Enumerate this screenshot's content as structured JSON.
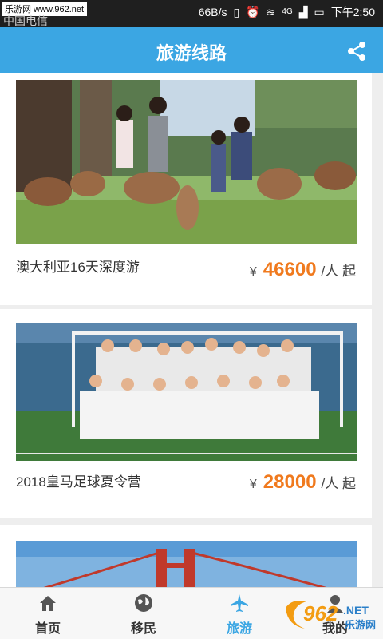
{
  "status_bar": {
    "watermark": "乐游网 www.962.net",
    "carrier": "中国电信",
    "speed": "66B/s",
    "network": "4G",
    "time": "下午2:50"
  },
  "header": {
    "title": "旅游线路",
    "share_icon": "share-icon"
  },
  "routes": [
    {
      "name": "澳大利亚16天深度游",
      "currency": "¥",
      "price": "46600",
      "unit": "/人 起"
    },
    {
      "name": "2018皇马足球夏令营",
      "currency": "¥",
      "price": "28000",
      "unit": "/人 起"
    }
  ],
  "tabs": [
    {
      "label": "首页",
      "icon": "home-icon"
    },
    {
      "label": "移民",
      "icon": "globe-icon"
    },
    {
      "label": "旅游",
      "icon": "airplane-icon",
      "active": true
    },
    {
      "label": "我的",
      "icon": "user-icon"
    }
  ],
  "brand": {
    "text": "962",
    "sub": ".NET",
    "caption": "乐游网"
  },
  "colors": {
    "accent": "#3ba6e3",
    "price": "#f07a1e"
  }
}
